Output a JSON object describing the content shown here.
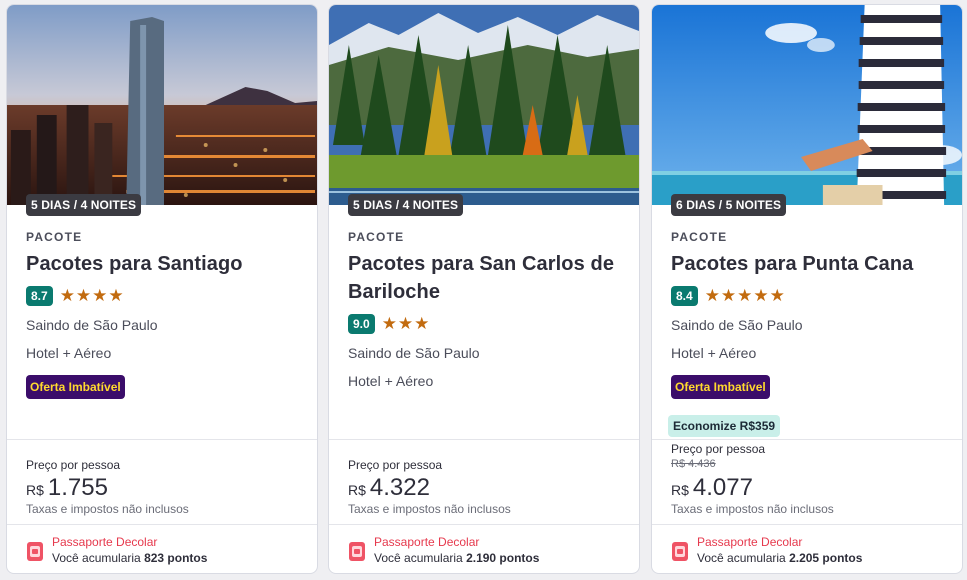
{
  "cards": [
    {
      "nights": "5 DIAS / 4 NOITES",
      "type": "PACOTE",
      "title": "Pacotes para Santiago",
      "score": "8.7",
      "stars": "★★★★",
      "origin": "Saindo de São Paulo",
      "includes": "Hotel + Aéreo",
      "badge": "Oferta Imbatível",
      "price_label": "Preço por pessoa",
      "currency": "R$",
      "price": "1.755",
      "taxes": "Taxas e impostos não inclusos",
      "passport_title": "Passaporte Decolar",
      "points_prefix": "Você acumularia",
      "points": "823 pontos"
    },
    {
      "nights": "5 DIAS / 4 NOITES",
      "type": "PACOTE",
      "title": "Pacotes para San Carlos de Bariloche",
      "score": "9.0",
      "stars": "★★★",
      "origin": "Saindo de São Paulo",
      "includes": "Hotel + Aéreo",
      "price_label": "Preço por pessoa",
      "currency": "R$",
      "price": "4.322",
      "taxes": "Taxas e impostos não inclusos",
      "passport_title": "Passaporte Decolar",
      "points_prefix": "Você acumularia",
      "points": "2.190 pontos"
    },
    {
      "nights": "6 DIAS / 5 NOITES",
      "type": "PACOTE",
      "title": "Pacotes para Punta Cana",
      "score": "8.4",
      "stars": "★★★★★",
      "origin": "Saindo de São Paulo",
      "includes": "Hotel + Aéreo",
      "badge": "Oferta Imbatível",
      "savings": "Economize R$359",
      "price_label": "Preço por pessoa",
      "old_price": "R$ 4.436",
      "currency": "R$",
      "price": "4.077",
      "taxes": "Taxas e impostos não inclusos",
      "passport_title": "Passaporte Decolar",
      "points_prefix": "Você acumularia",
      "points": "2.205 pontos"
    }
  ],
  "colors": {
    "score_bg": "#0a7a6f",
    "star": "#c26b0f",
    "badge_bg": "#3b0d6a",
    "badge_text": "#ffd92e",
    "savings_bg": "#c9efe9",
    "passport_red": "#e6394d"
  },
  "icons": [
    "passport-icon"
  ]
}
